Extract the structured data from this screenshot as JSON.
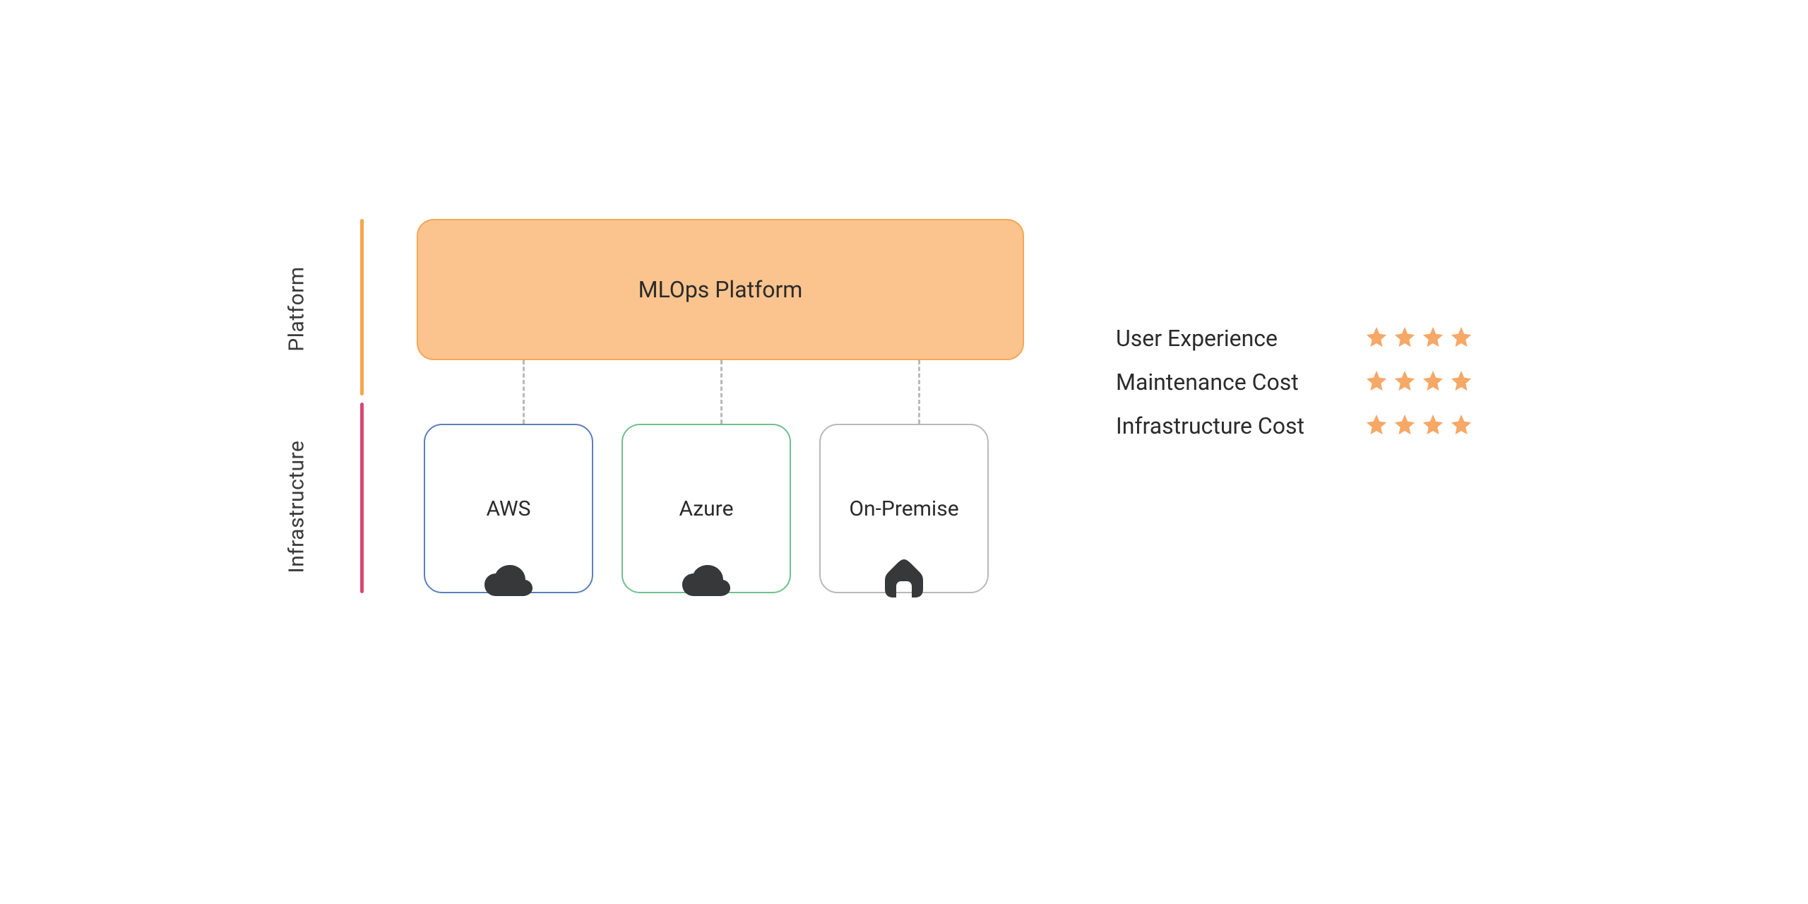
{
  "sections": {
    "platform_label": "Platform",
    "infrastructure_label": "Infrastructure"
  },
  "platform": {
    "title": "MLOps Platform",
    "fill": "#fbc48e",
    "border": "#f4a757"
  },
  "infrastructure": {
    "nodes": [
      {
        "label": "AWS",
        "icon": "cloud",
        "border": "#5b7fb8"
      },
      {
        "label": "Azure",
        "icon": "cloud",
        "border": "#6fbf8e"
      },
      {
        "label": "On-Premise",
        "icon": "home",
        "border": "#b9b9b9"
      }
    ]
  },
  "ratings": [
    {
      "label": "User Experience",
      "stars": 4
    },
    {
      "label": "Maintenance Cost",
      "stars": 4
    },
    {
      "label": "Infrastructure Cost",
      "stars": 4
    }
  ],
  "colors": {
    "star": "#f6a867",
    "platform_bar": "#f6a64c",
    "infra_bar": "#d84a72",
    "icon_fill": "#36383a"
  }
}
